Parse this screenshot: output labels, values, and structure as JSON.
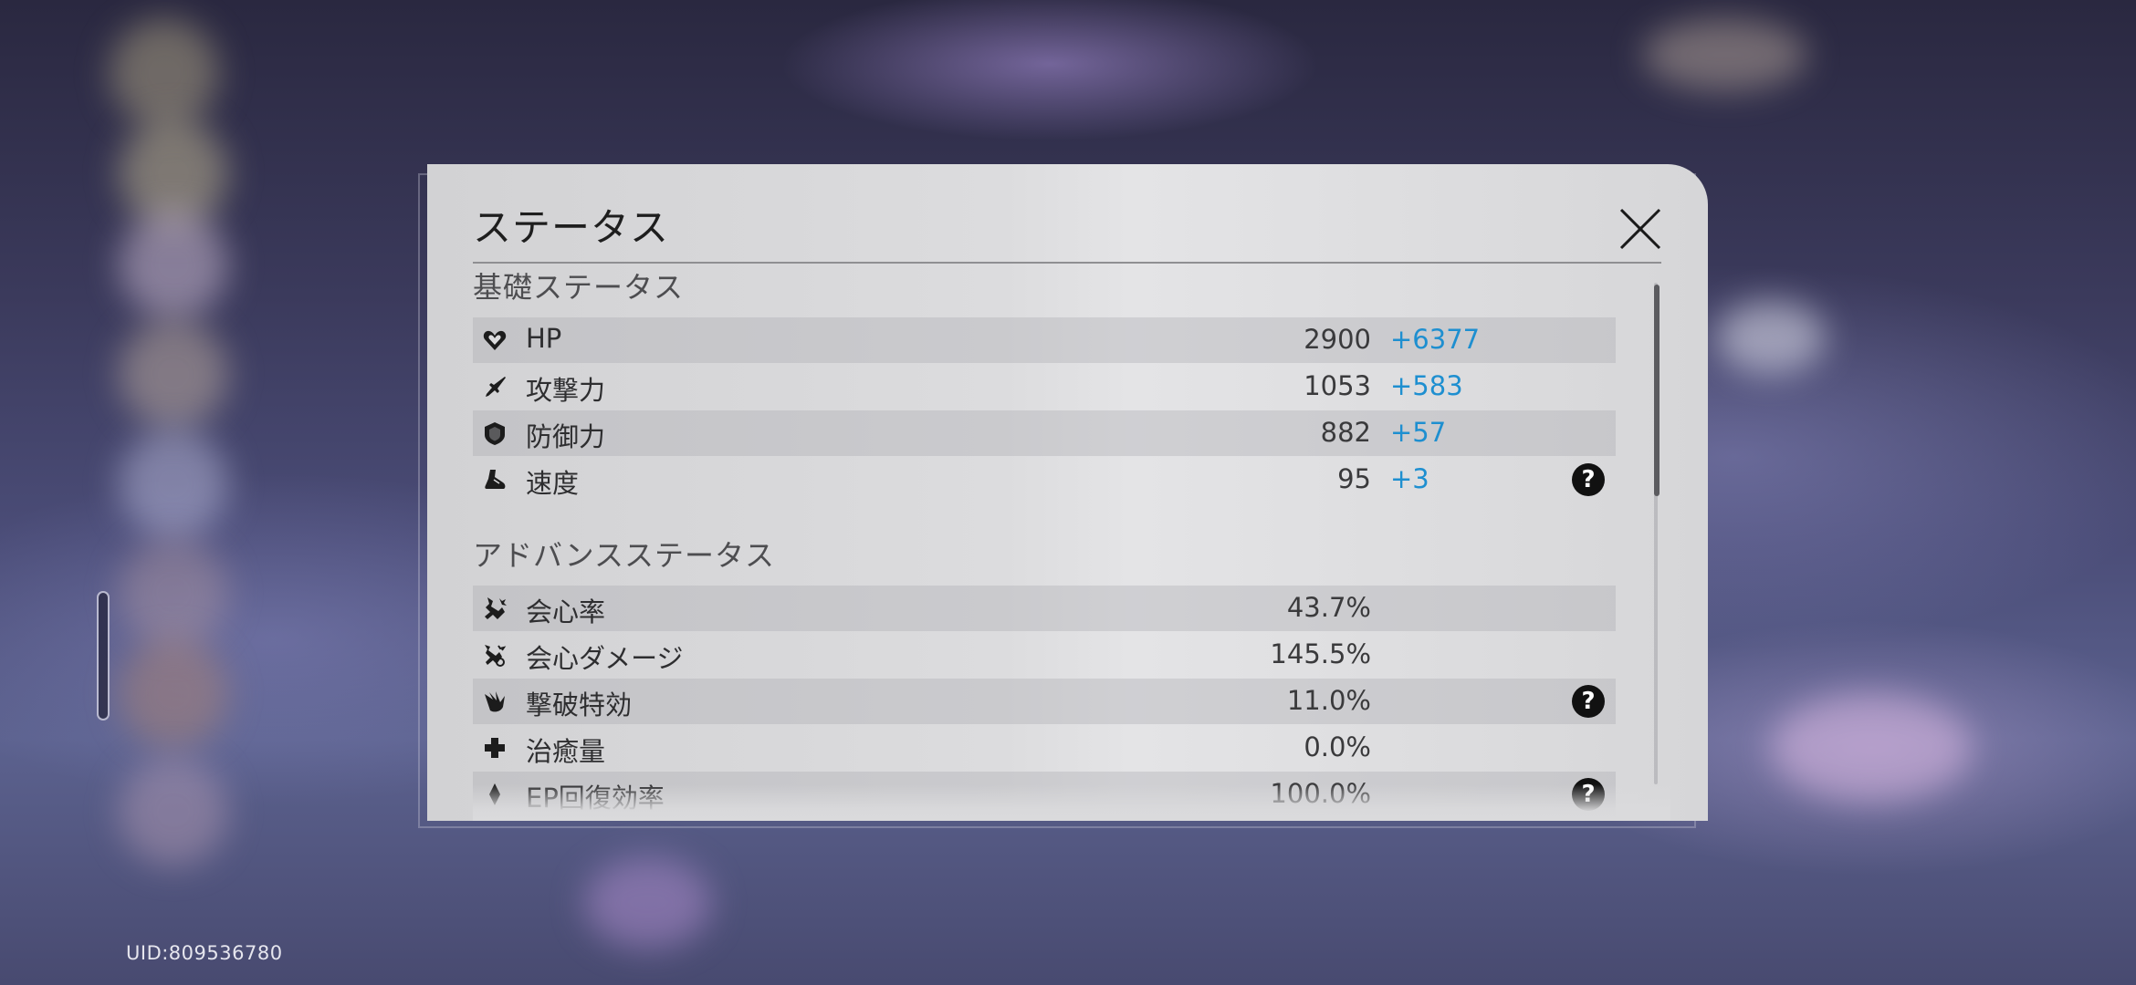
{
  "footer": {
    "uid": "UID:809536780"
  },
  "dialog": {
    "title": "ステータス",
    "close_icon": "close-x-icon"
  },
  "basic": {
    "title": "基礎ステータス",
    "rows": [
      {
        "label": "HP",
        "value": "2900",
        "bonus": "+6377",
        "icon": "heart-icon",
        "help": ""
      },
      {
        "label": "攻撃力",
        "value": "1053",
        "bonus": "+583",
        "icon": "sword-icon",
        "help": ""
      },
      {
        "label": "防御力",
        "value": "882",
        "bonus": "+57",
        "icon": "shield-icon",
        "help": ""
      },
      {
        "label": "速度",
        "value": "95",
        "bonus": "+3",
        "icon": "boot-icon",
        "help": "?"
      }
    ]
  },
  "advanced": {
    "title": "アドバンスステータス",
    "rows": [
      {
        "label": "会心率",
        "value": "43.7%",
        "icon": "crit-rate-icon",
        "help": ""
      },
      {
        "label": "会心ダメージ",
        "value": "145.5%",
        "icon": "crit-damage-icon",
        "help": ""
      },
      {
        "label": "撃破特効",
        "value": "11.0%",
        "icon": "break-effect-icon",
        "help": "?"
      },
      {
        "label": "治癒量",
        "value": "0.0%",
        "icon": "healing-cross-icon",
        "help": ""
      },
      {
        "label": "EP回復効率",
        "value": "100.0%",
        "icon": "energy-regen-icon",
        "help": "?"
      }
    ]
  },
  "colors": {
    "bonus": "#1e8fd0",
    "panel": "#dcdcde",
    "help_button": "#111111"
  }
}
